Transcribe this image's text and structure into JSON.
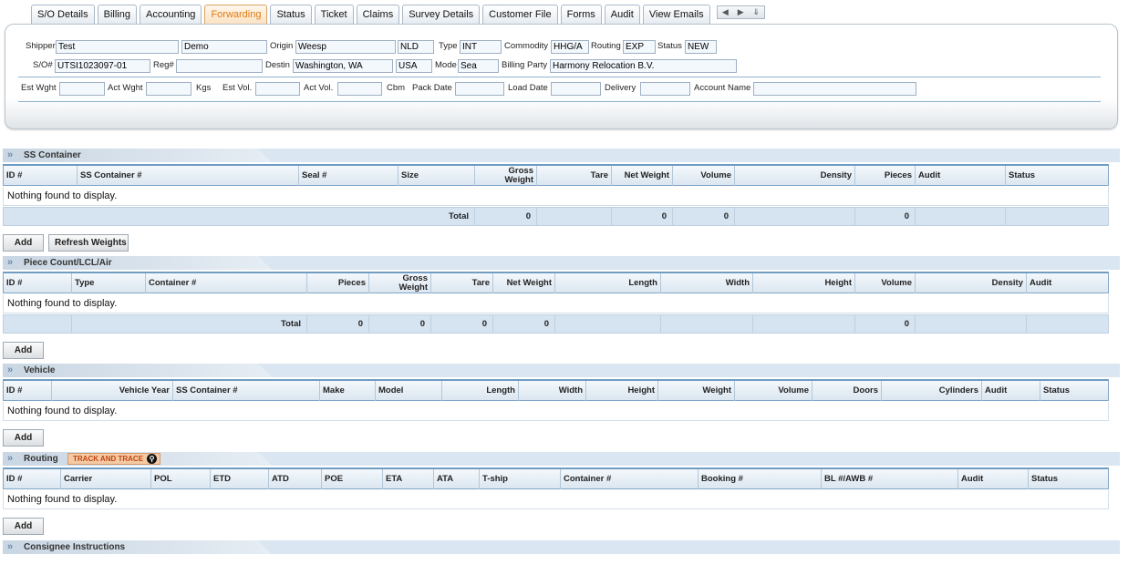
{
  "tabs": [
    "S/O Details",
    "Billing",
    "Accounting",
    "Forwarding",
    "Status",
    "Ticket",
    "Claims",
    "Survey Details",
    "Customer File",
    "Forms",
    "Audit",
    "View Emails"
  ],
  "active_tab": "Forwarding",
  "tab_nav": {
    "prev": "◀",
    "next": "▶",
    "down": "⇓"
  },
  "header": {
    "shipper_label": "Shipper",
    "shipper_value": "Test",
    "shipper_last": "Demo",
    "origin_label": "Origin",
    "origin_value": "Weesp",
    "origin_country": "NLD",
    "type_label": "Type",
    "type_value": "INT",
    "commodity_label": "Commodity",
    "commodity_value": "HHG/A",
    "routing_label": "Routing",
    "routing_value": "EXP",
    "status_label": "Status",
    "status_value": "NEW",
    "so_label": "S/O#",
    "so_value": "UTSI1023097-01",
    "reg_label": "Reg#",
    "reg_value": "",
    "destin_label": "Destin",
    "destin_value": "Washington, WA",
    "destin_country": "USA",
    "mode_label": "Mode",
    "mode_value": "Sea",
    "billing_party_label": "Billing Party",
    "billing_party_value": "Harmony Relocation B.V.",
    "est_wght_label": "Est Wght",
    "act_wght_label": "Act Wght",
    "kgs_label": "Kgs",
    "est_vol_label": "Est Vol.",
    "act_vol_label": "Act Vol.",
    "cbm_label": "Cbm",
    "pack_date_label": "Pack Date",
    "load_date_label": "Load Date",
    "delivery_label": "Delivery",
    "account_name_label": "Account Name"
  },
  "empty_text": "Nothing found to display.",
  "total_label": "Total",
  "add_label": "Add",
  "ss_container": {
    "title": "SS Container",
    "columns": [
      "ID #",
      "SS Container #",
      "Seal #",
      "Size",
      "Gross Weight",
      "Tare",
      "Net Weight",
      "Volume",
      "Density",
      "Pieces",
      "Audit",
      "Status"
    ],
    "totals": {
      "gross": "0",
      "net": "0",
      "volume": "0",
      "pieces": "0"
    },
    "refresh_label": "Refresh Weights"
  },
  "piece_count": {
    "title": "Piece Count/LCL/Air",
    "columns": [
      "ID #",
      "Type",
      "Container #",
      "Pieces",
      "Gross Weight",
      "Tare",
      "Net Weight",
      "Length",
      "Width",
      "Height",
      "Volume",
      "Density",
      "Audit"
    ],
    "totals": {
      "pieces": "0",
      "gross": "0",
      "tare": "0",
      "net": "0",
      "volume": "0"
    }
  },
  "vehicle": {
    "title": "Vehicle",
    "columns": [
      "ID #",
      "Vehicle Year",
      "SS Container #",
      "Make",
      "Model",
      "Length",
      "Width",
      "Height",
      "Weight",
      "Volume",
      "Doors",
      "Cylinders",
      "Audit",
      "Status"
    ]
  },
  "routing": {
    "title": "Routing",
    "track_label": "TRACK AND TRACE",
    "columns": [
      "ID #",
      "Carrier",
      "POL",
      "ETD",
      "ATD",
      "POE",
      "ETA",
      "ATA",
      "T-ship",
      "Container #",
      "Booking #",
      "BL #/AWB #",
      "Audit",
      "Status"
    ]
  },
  "consignee": {
    "title": "Consignee Instructions"
  }
}
